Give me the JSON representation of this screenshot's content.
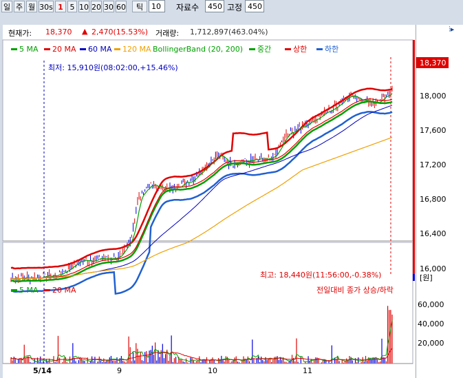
{
  "toolbar": {
    "period_buttons": [
      "일",
      "주",
      "월",
      "30s",
      "1",
      "5",
      "10",
      "20",
      "30",
      "60"
    ],
    "tick_label": "틱",
    "tick_value": "10",
    "count_label": "자료수",
    "count_value": "450",
    "fixed_label": "고정",
    "fixed_value": "450"
  },
  "info": {
    "price_label": "현재가:",
    "price_value": "18,370",
    "change_value": "2,470(15.53%)",
    "volume_label": "거래량:",
    "volume_value": "1,712,897(463.04%)"
  },
  "legend": {
    "ma5": "5 MA",
    "ma20": "20 MA",
    "ma60": "60 MA",
    "ma120": "120 MA",
    "bb": "BollingerBand (20, 200)",
    "mid": "중간",
    "upper": "상한",
    "lower": "하한"
  },
  "annotations": {
    "low": "최저: 15,910원(08:02:00,+15.46%)",
    "high": "최고: 18,440원(11:56:00,-0.38%)",
    "volume_note": "전일대비 종가 상승/하락"
  },
  "vol_legend": {
    "ma5": "5 MA",
    "ma20": "20 MA"
  },
  "price_axis": {
    "current": "18,370",
    "ticks": [
      "18,000",
      "17,600",
      "17,200",
      "16,800",
      "16,400",
      "16,000"
    ],
    "unit": "원"
  },
  "volume_axis": {
    "ticks": [
      "60,000",
      "40,000",
      "20,000"
    ]
  },
  "x_axis": {
    "labels": [
      "5/14",
      "9",
      "10",
      "11"
    ]
  },
  "colors": {
    "ma5": "#00a000",
    "ma20": "#e00000",
    "ma60": "#0000c0",
    "ma120": "#f0a000",
    "bb_mid": "#00a000",
    "bb_upper": "#e00000",
    "bb_lower": "#2060d0",
    "up": "#e00000",
    "down": "#0000e0"
  },
  "icons": {
    "settings": "settings-icon"
  }
}
